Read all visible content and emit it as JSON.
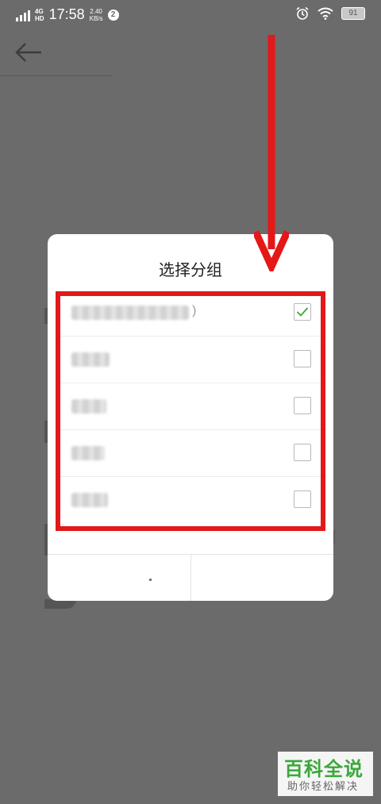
{
  "status_bar": {
    "network": "4G",
    "network_sub": "HD",
    "time": "17:58",
    "speed_value": "2.40",
    "speed_unit": "KB/s",
    "notification_count": "2",
    "battery": "91"
  },
  "dialog": {
    "title": "选择分组",
    "groups": [
      {
        "checked": true,
        "suffix": ")"
      },
      {
        "checked": false
      },
      {
        "checked": false
      },
      {
        "checked": false
      },
      {
        "checked": false
      }
    ]
  },
  "watermark": {
    "logo": "百科全说",
    "subtitle": "助你轻松解决"
  },
  "colors": {
    "overlay": "#6b6b6b",
    "highlight": "#e31818",
    "check": "#3aa83a"
  }
}
